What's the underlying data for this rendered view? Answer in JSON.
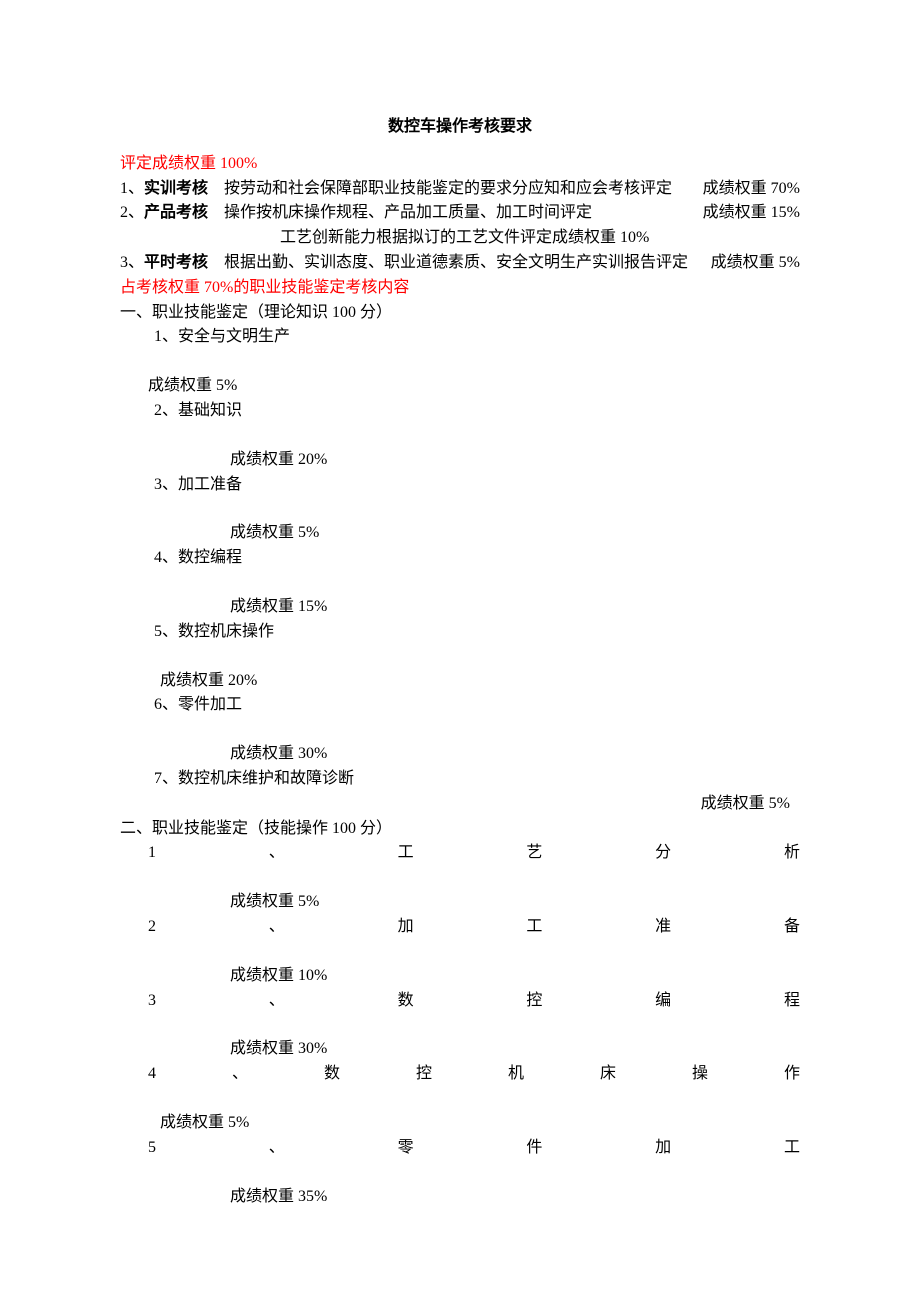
{
  "title": "数控车操作考核要求",
  "header_red": "评定成绩权重 100%",
  "main_items": [
    {
      "num": "1、",
      "bold": "实训考核",
      "desc": "　按劳动和社会保障部职业技能鉴定的要求分应知和应会考核评定",
      "weight": "成绩权重 70%"
    },
    {
      "num": "2、",
      "bold": "产品考核",
      "desc": "　操作按机床操作规程、产品加工质量、加工时间评定",
      "weight": "成绩权重 15%"
    }
  ],
  "main_item_2_sub": "工艺创新能力根据拟订的工艺文件评定成绩权重 10%",
  "main_item_3": {
    "num": "3、",
    "bold": "平时考核",
    "desc": "　根据出勤、实训态度、职业道德素质、安全文明生产实训报告评定",
    "weight": "成绩权重 5%"
  },
  "section_red": "占考核权重 70%的职业技能鉴定考核内容",
  "section_a_title": "一、职业技能鉴定（理论知识 100 分）",
  "theory_items": [
    {
      "label": "1、安全与文明生产",
      "weight": "成绩权重 5%",
      "weight_class": "indent-1"
    },
    {
      "label": "2、基础知识",
      "weight": "成绩权重 20%",
      "weight_class": "weight-inline"
    },
    {
      "label": "3、加工准备",
      "weight": "成绩权重 5%",
      "weight_class": "weight-inline"
    },
    {
      "label": "4、数控编程",
      "weight": "成绩权重 15%",
      "weight_class": "weight-inline"
    },
    {
      "label": "5、数控机床操作",
      "weight": "成绩权重 20%",
      "weight_class": "weight-inline-2"
    },
    {
      "label": "6、零件加工",
      "weight": "成绩权重 30%",
      "weight_class": "weight-inline"
    }
  ],
  "theory_item_7": {
    "label": "7、数控机床维护和故障诊断",
    "weight": "成绩权重 5%"
  },
  "section_b_title": "二、职业技能鉴定（技能操作 100 分）",
  "skill_items": [
    {
      "num": "1",
      "sep": "、",
      "chars": [
        "工",
        "艺",
        "分",
        "析"
      ],
      "weight": "成绩权重 5%"
    },
    {
      "num": "2",
      "sep": "、",
      "chars": [
        "加",
        "工",
        "准",
        "备"
      ],
      "weight": "成绩权重 10%"
    },
    {
      "num": "3",
      "sep": "、",
      "chars": [
        "数",
        "控",
        "编",
        "程"
      ],
      "weight": "成绩权重 30%"
    },
    {
      "num": "4",
      "sep": "、",
      "chars": [
        "数",
        "控",
        "机",
        "床",
        "操",
        "作"
      ],
      "weight": "成绩权重 5%"
    },
    {
      "num": "5",
      "sep": "、",
      "chars": [
        "零",
        "件",
        "加",
        "工"
      ],
      "weight": "成绩权重 35%"
    }
  ]
}
